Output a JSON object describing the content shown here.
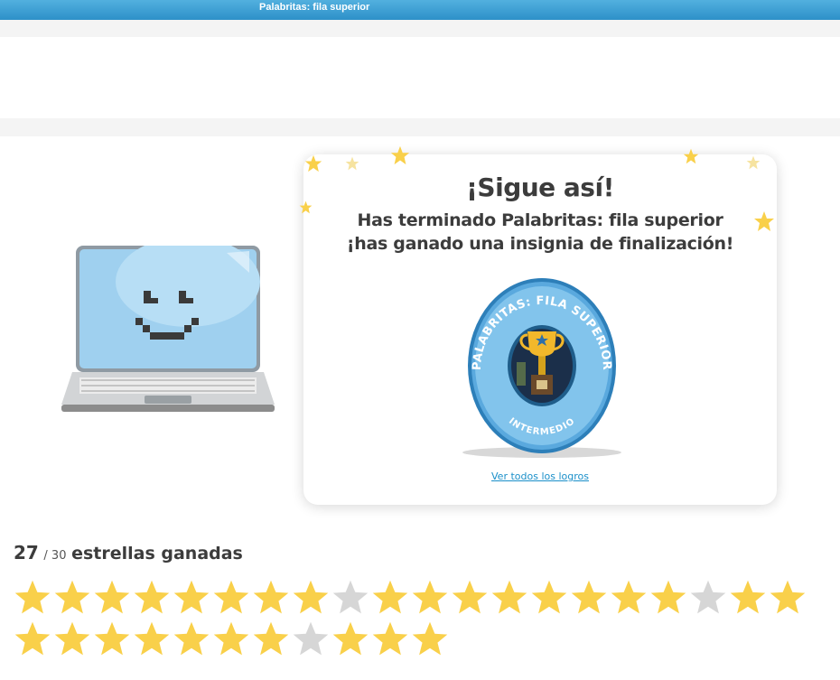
{
  "topbar": {
    "title": "Palabritas: fila superior"
  },
  "completion": {
    "heading": "¡Sigue así!",
    "line1": "Has terminado Palabritas: fila superior",
    "line2": "¡has ganado una insignia de finalización!",
    "link": "Ver todos los logros"
  },
  "badge": {
    "top_text": "PALABRITAS: FILA SUPERIOR",
    "bottom_text": "INTERMEDIO",
    "icon": "trophy-icon"
  },
  "stars": {
    "earned": "27",
    "total": "/ 30",
    "label": "estrellas ganadas",
    "earned_color": "#f9d04a",
    "empty_color": "#d6d6d6",
    "row": [
      1,
      1,
      1,
      1,
      1,
      1,
      1,
      1,
      0,
      1,
      1,
      1,
      1,
      1,
      1,
      1,
      1,
      0,
      1,
      1,
      1,
      1,
      1,
      1,
      1,
      1,
      1,
      0,
      1,
      1,
      1
    ]
  }
}
